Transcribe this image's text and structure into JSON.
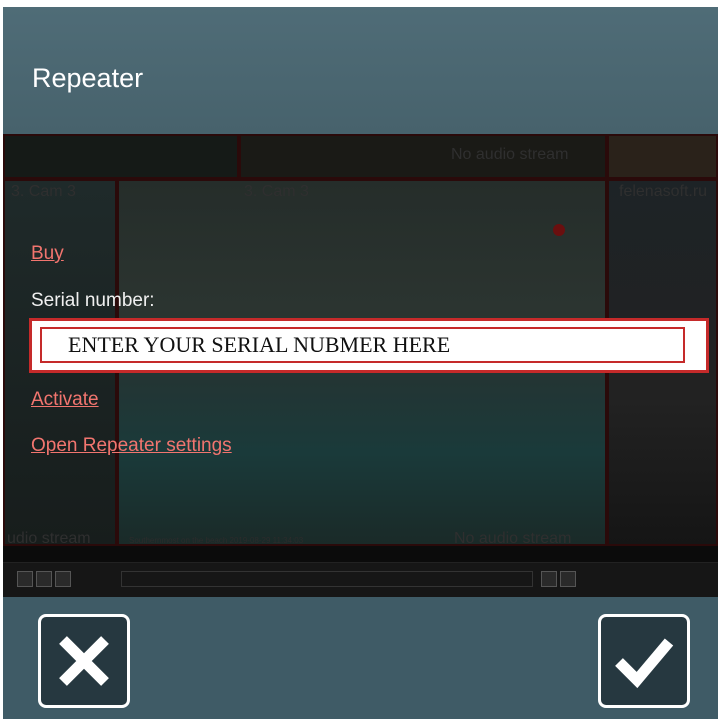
{
  "dialog": {
    "title": "Repeater"
  },
  "background": {
    "top_right_label": "No audio stream",
    "cam_label_1": "3. Cam 3",
    "cam_label_2": "3. Cam 3",
    "site_label": "felenasoft.ru",
    "bottom_left_label": "udio stream",
    "bottom_right_label": "No audio stream",
    "bottom_center_small": "Southernmost on the beach 2019-08-29 11:34:03"
  },
  "links": {
    "buy": "Buy",
    "activate": "Activate",
    "open_settings": "Open Repeater settings"
  },
  "serial": {
    "label": "Serial number:",
    "value": "ENTER YOUR SERIAL NUBMER HERE"
  },
  "footer": {
    "cancel_icon": "close-icon",
    "confirm_icon": "checkmark-icon"
  },
  "colors": {
    "accent_link": "#f2756f",
    "highlight_border": "#c52a2a",
    "header_bg": "#4f6c77"
  }
}
